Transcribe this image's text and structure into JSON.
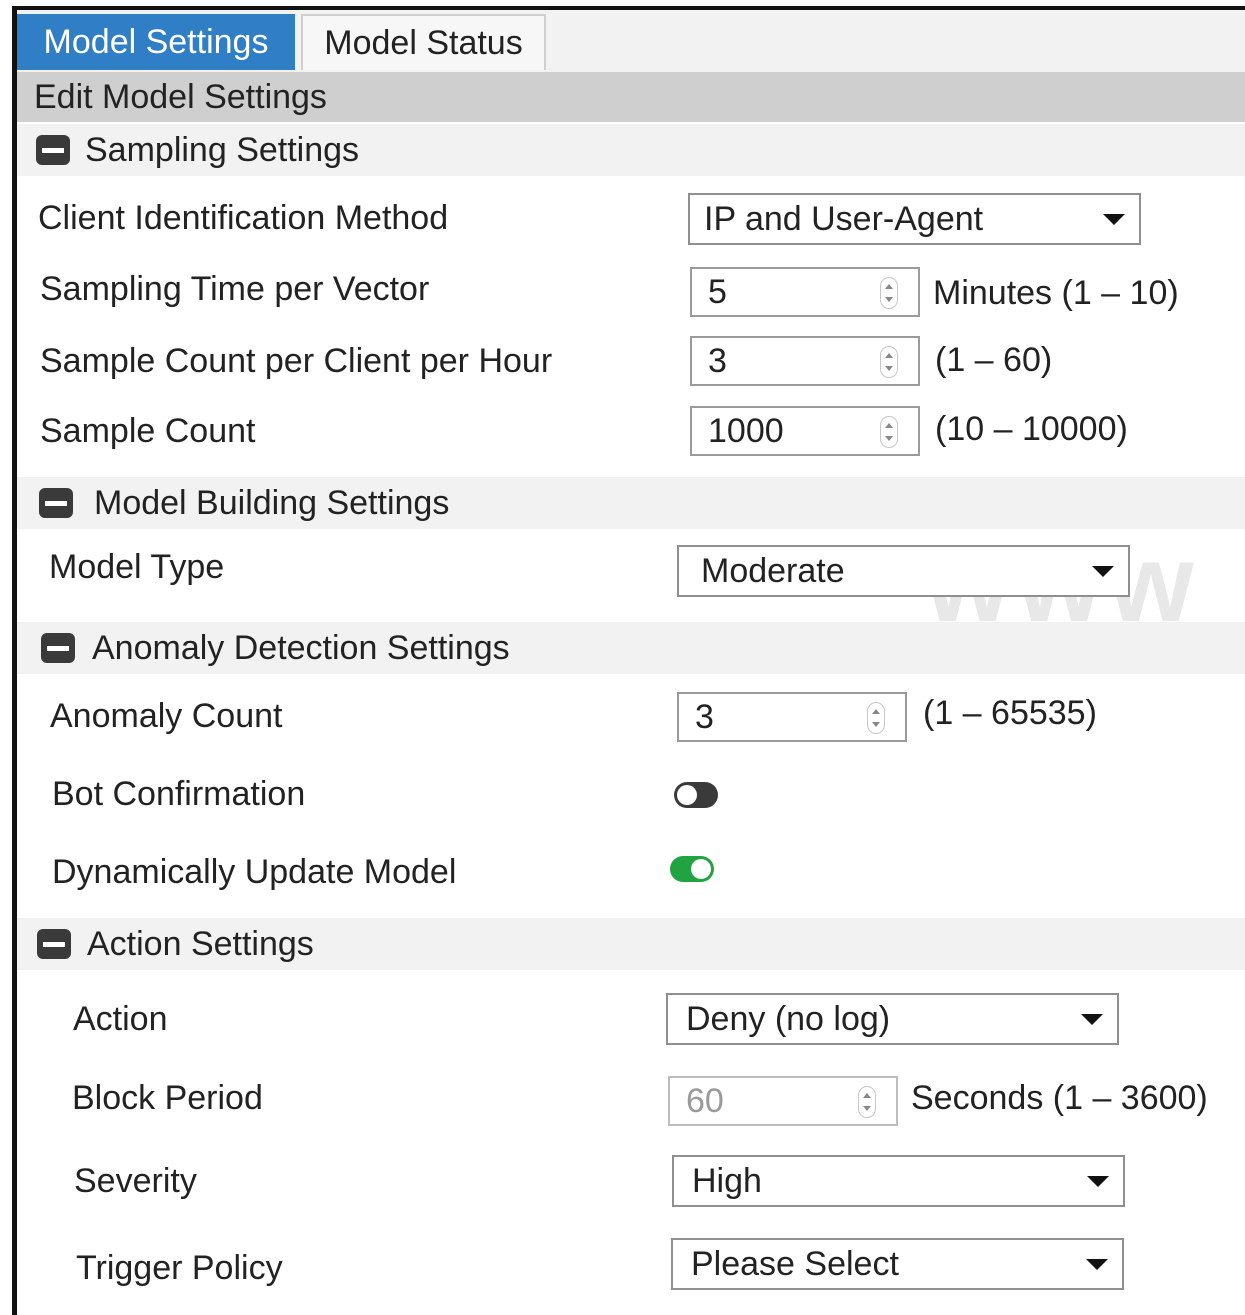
{
  "tabs": [
    {
      "label": "Model Settings",
      "active": true
    },
    {
      "label": "Model Status",
      "active": false
    }
  ],
  "header": {
    "title": "Edit Model Settings"
  },
  "sampling": {
    "title": "Sampling Settings",
    "client_id_label": "Client Identification Method",
    "client_id_value": "IP and User-Agent",
    "time_label": "Sampling Time per Vector",
    "time_value": "5",
    "time_hint": "Minutes (1 – 10)",
    "count_client_label": "Sample Count per Client per Hour",
    "count_client_value": "3",
    "count_client_hint": "(1 – 60)",
    "count_label": "Sample Count",
    "count_value": "1000",
    "count_hint": "(10 – 10000)"
  },
  "model_building": {
    "title": "Model Building Settings",
    "type_label": "Model Type",
    "type_value": "Moderate"
  },
  "anomaly": {
    "title": "Anomaly Detection Settings",
    "count_label": "Anomaly Count",
    "count_value": "3",
    "count_hint": "(1 – 65535)",
    "bot_label": "Bot Confirmation",
    "bot_on": false,
    "dynamic_label": "Dynamically Update Model",
    "dynamic_on": true
  },
  "action": {
    "title": "Action Settings",
    "action_label": "Action",
    "action_value": "Deny (no log)",
    "block_label": "Block Period",
    "block_value": "60",
    "block_hint": "Seconds (1 – 3600)",
    "severity_label": "Severity",
    "severity_value": "High",
    "trigger_label": "Trigger Policy",
    "trigger_value": "Please Select"
  },
  "watermark": "www",
  "colors": {
    "accent": "#2f7ec6",
    "toggle_on": "#21a341",
    "toggle_off": "#3a3a3a",
    "header_bg": "#cfcfcf"
  }
}
